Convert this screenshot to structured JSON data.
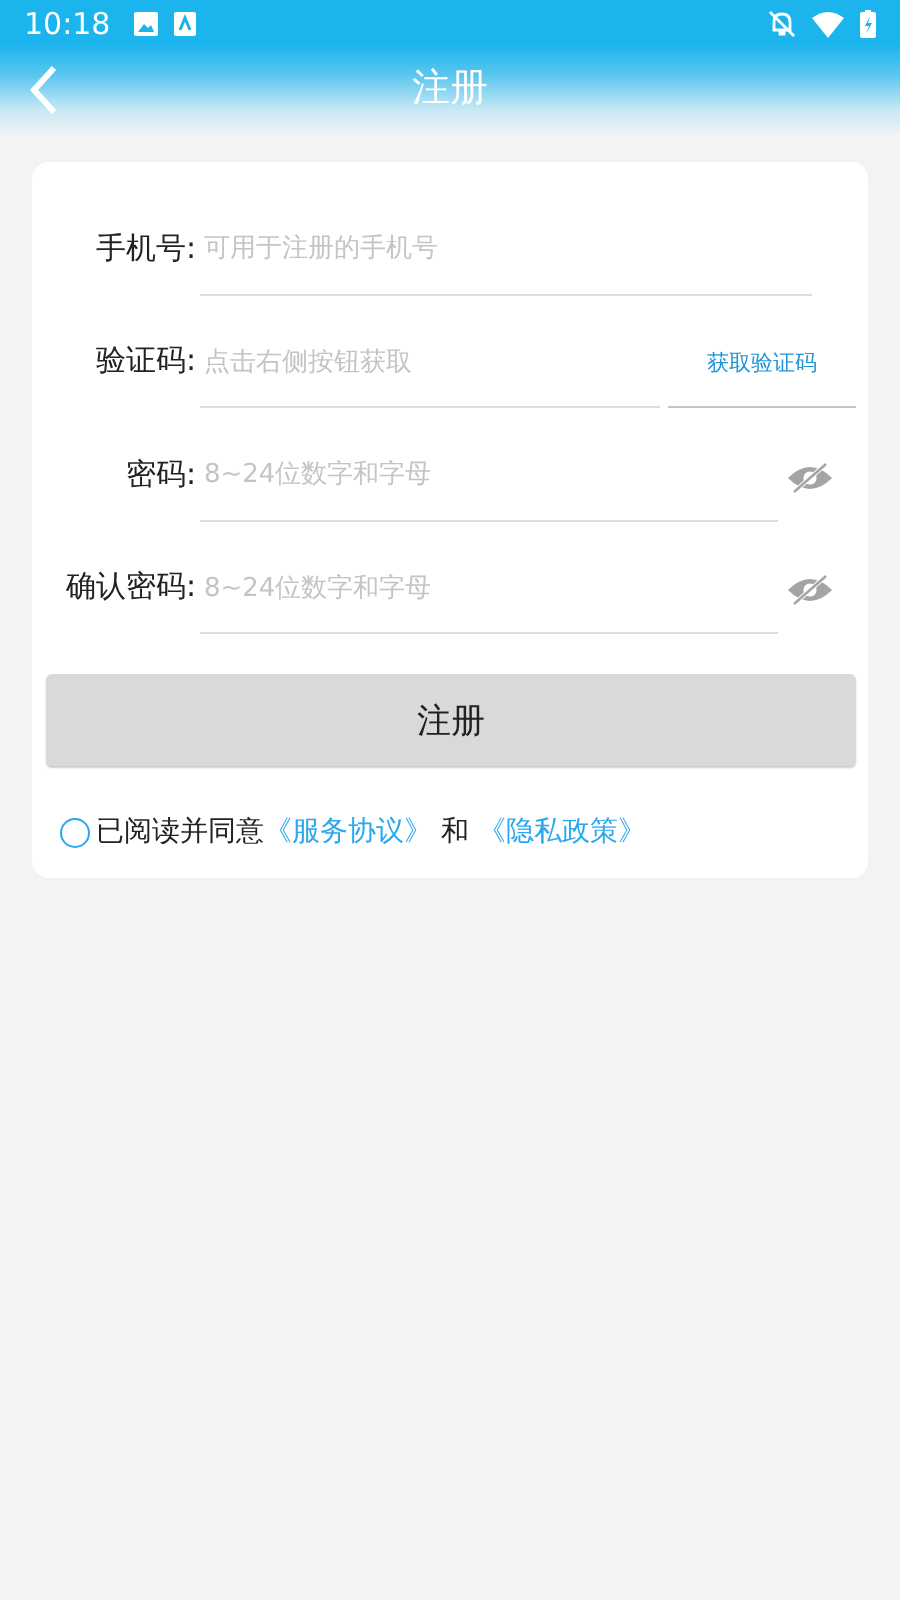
{
  "status_bar": {
    "time": "10:18"
  },
  "header": {
    "title": "注册"
  },
  "fields": [
    {
      "kind": "plain",
      "label": "手机号:",
      "placeholder": "可用于注册的手机号"
    },
    {
      "kind": "code",
      "label": "验证码:",
      "placeholder": "点击右侧按钮获取",
      "button": "获取验证码"
    },
    {
      "kind": "password",
      "label": "密码:",
      "placeholder": "8~24位数字和字母"
    },
    {
      "kind": "password",
      "label": "确认密码:",
      "placeholder": "8~24位数字和字母"
    }
  ],
  "submit": "注册",
  "agreement": {
    "checked": false,
    "text": "已阅读并同意",
    "links": [
      "《服务协议》",
      "《隐私政策》"
    ],
    "joiner": "和"
  }
}
